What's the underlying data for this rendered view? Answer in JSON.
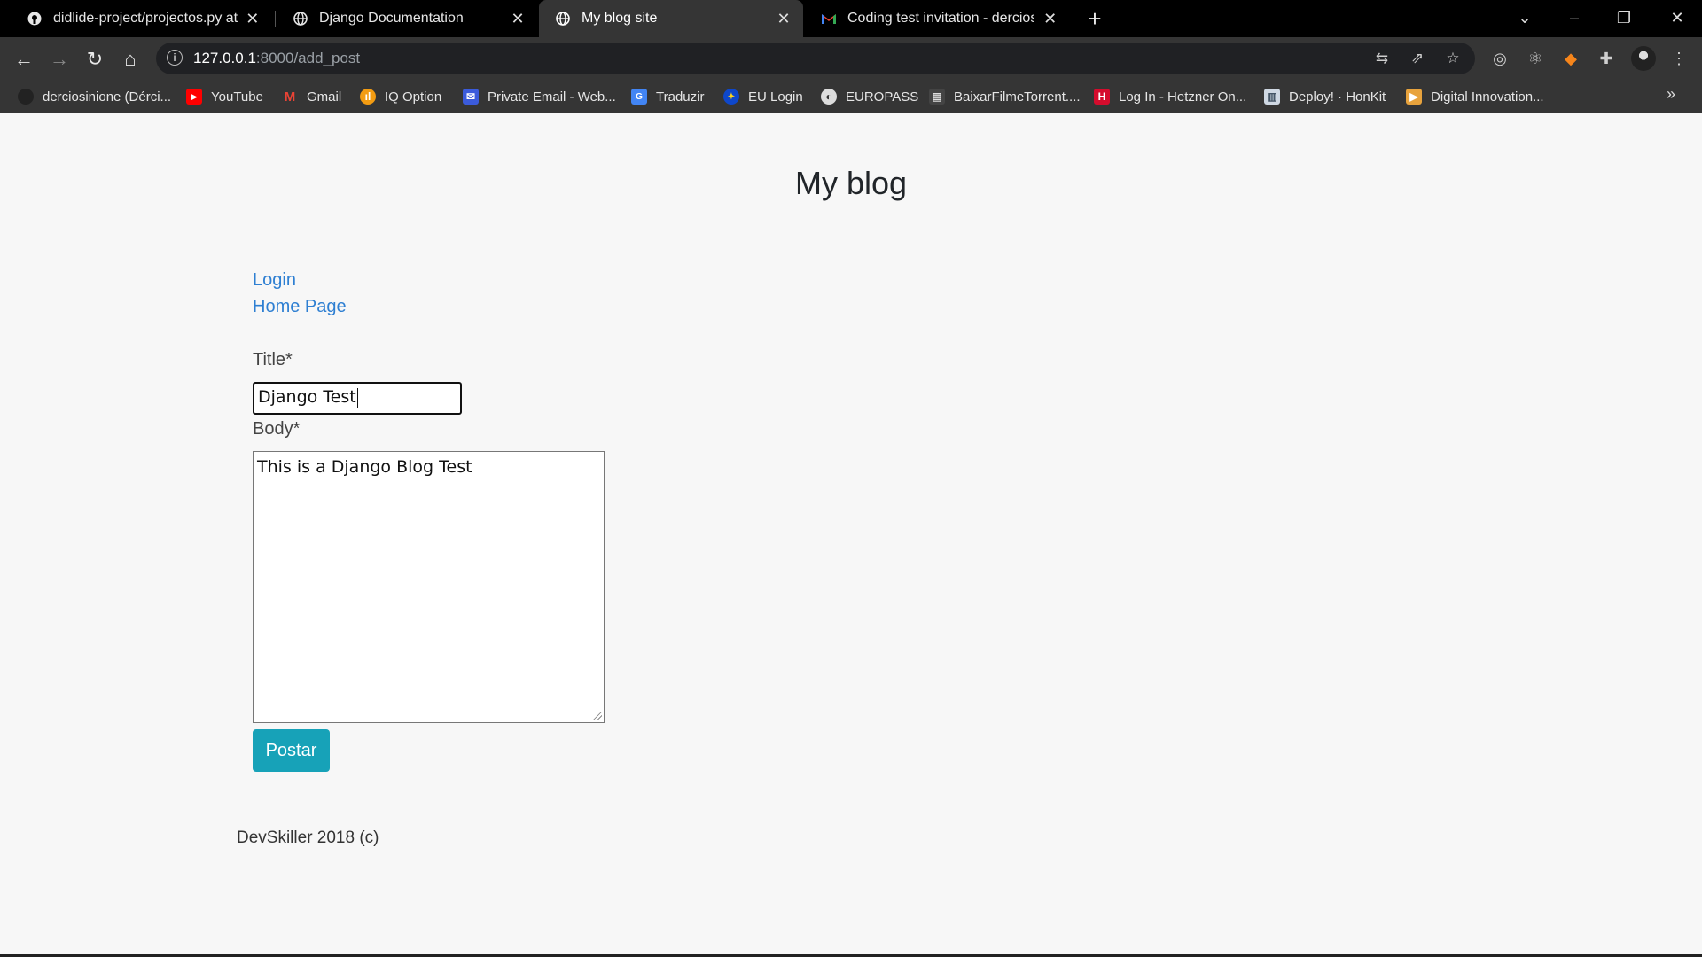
{
  "browser": {
    "tabs": [
      {
        "title": "didlide-project/projectos.py at m",
        "favicon": "github-icon",
        "active": false
      },
      {
        "title": "Django Documentation",
        "favicon": "globe-icon",
        "active": false
      },
      {
        "title": "My blog site",
        "favicon": "globe-icon",
        "active": true
      },
      {
        "title": "Coding test invitation - derciosin",
        "favicon": "gmail-icon",
        "active": false
      }
    ],
    "url_host": "127.0.0.1",
    "url_path": ":8000/add_post",
    "bookmarks": [
      {
        "label": "derciosinione (Dérci...",
        "icon": "github-icon",
        "color": "#222222"
      },
      {
        "label": "YouTube",
        "icon": "youtube-icon",
        "color": "#ff0000"
      },
      {
        "label": "Gmail",
        "icon": "gmail-icon",
        "color": "#ea4335"
      },
      {
        "label": "IQ Option",
        "icon": "iq-option-icon",
        "color": "#f39c12"
      },
      {
        "label": "Private Email - Web...",
        "icon": "email-icon",
        "color": "#3b5bdb"
      },
      {
        "label": "Traduzir",
        "icon": "translate-icon",
        "color": "#4285f4"
      },
      {
        "label": "EU Login",
        "icon": "eu-icon",
        "color": "#0e47cb"
      },
      {
        "label": "EUROPASS",
        "icon": "globe-icon",
        "color": "#dddddd"
      },
      {
        "label": "BaixarFilmeTorrent....",
        "icon": "film-icon",
        "color": "#444444"
      },
      {
        "label": "Log In - Hetzner On...",
        "icon": "hetzner-icon",
        "color": "#d50c2d"
      },
      {
        "label": "Deploy! · HonKit",
        "icon": "book-icon",
        "color": "#cfd8e3"
      },
      {
        "label": "Digital Innovation...",
        "icon": "dio-icon",
        "color": "#e8a33d"
      }
    ]
  },
  "page": {
    "heading": "My blog",
    "links": {
      "login": "Login",
      "home": "Home Page"
    },
    "form": {
      "title_label": "Title*",
      "title_value": "Django Test",
      "body_label": "Body*",
      "body_value": "This is a Django Blog Test",
      "submit_label": "Postar"
    },
    "footer": "DevSkiller 2018 (c)"
  },
  "colors": {
    "accent_button": "#17a2b8",
    "link": "#2e7fd2"
  }
}
